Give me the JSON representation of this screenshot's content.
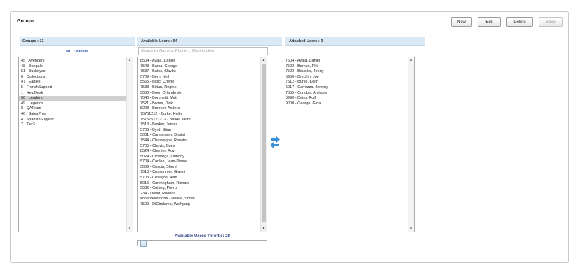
{
  "panel": {
    "title": "Groups"
  },
  "toolbar": {
    "new_label": "New",
    "edit_label": "Edit",
    "delete_label": "Delete",
    "save_label": "Save"
  },
  "groups": {
    "header": "Groups : 13",
    "selected_label": "50 : Leaders",
    "selected_index": 8,
    "items": [
      "45 : Avengers",
      "48 : Bengals",
      "51 : Buckeyes",
      "6 : Collections",
      "47 : Eagles",
      "5 : FrenchSupport",
      "1 : HelpDesk",
      "50 : Leaders",
      "49 : Legends",
      "8 : QATeam",
      "46 : SalesPros",
      "4 : SpanishSupport",
      "7 : Tier3"
    ]
  },
  "available": {
    "header": "Available Users : 64",
    "search_placeholder": "Search by Name or Phone ... (Esc) to clear",
    "items": [
      "8504 - Ayala, Daniel",
      "7548 - Barsa, George",
      "7537 - Bates, Slavko",
      "5709 - Bern, Neil",
      "5555 - Bibic, Cherie",
      "7538 - Bittan, Regine",
      "5030 - Boer, Orlando de",
      "7540 - Borghetti, Matt",
      "7521 - Bozas, Dick",
      "5228 - Brooker, Anders",
      "75751212 - Burke, Keith",
      "757575121212 - Burke, Keith",
      "7513 - Busker, James",
      "5706 - Byrd, Stian",
      "5031 - Carstensen, Dimitri",
      "7544 - Chassagne, Renato",
      "5705 - Chavis, Boris",
      "8524 - Chenier, Roy",
      "5024 - Cicierega, Lemony",
      "5704 - Conlee, Jean-Pierre",
      "5009 - Coscia, Sheryl",
      "7518 - Croisonnier, Gianni",
      "5703 - Crowçoe, Alan",
      "5016 - Cunningham, Richard",
      "5032 - Cutting, Pietro",
      "234 - David, Rhonda",
      "sonardeletefone - Delete, Sonar",
      "7509 - DiGirolamo, Wolfgang"
    ],
    "throttle_label": "Available Users Throttle: 28",
    "throttle_fraction": 0.02
  },
  "attached": {
    "header": "Attached Users : 9",
    "items": [
      "7504 - Ayala, Daniel",
      "7502 - Barnes, Phil",
      "7522 - Bouclier, Jenny",
      "5950 - Brechin, Joe",
      "7512 - Burke, Keith",
      "5017 - Carrozza, Jeremy",
      "7505 - Condon, Anthony",
      "5990 - Deiro, Rolf",
      "9000 - George, Gina"
    ]
  },
  "colors": {
    "accent": "#3a8fd6",
    "header_bg": "#dbe9f4",
    "selection": "#cfcfcf"
  },
  "icons": {
    "transfer": "transfer-arrows-icon"
  }
}
